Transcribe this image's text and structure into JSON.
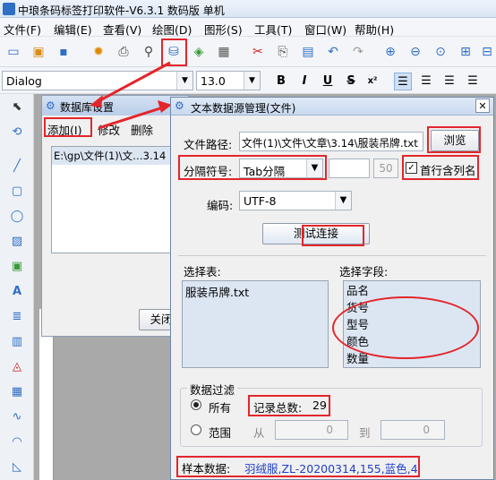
{
  "app": {
    "title": "中琅条码标签打印软件-V6.3.1 数码版 单机"
  },
  "menu": [
    "文件(F)",
    "编辑(E)",
    "查看(V)",
    "绘图(D)",
    "图形(S)",
    "工具(T)",
    "窗口(W)",
    "帮助(H)"
  ],
  "toolbar": {
    "font_name": "Dialog",
    "font_size": "13.0",
    "bold": "B",
    "italic": "I",
    "underline": "U",
    "strike": "S"
  },
  "db_window": {
    "title": "数据库设置",
    "add": "添加(I)",
    "edit": "修改",
    "delete": "删除",
    "item": "E:\\gp\\文件(1)\\文…3.14",
    "close": "关闭"
  },
  "dialog": {
    "title": "文本数据源管理(文件)",
    "close_glyph": "✕",
    "path_label": "文件路径:",
    "path_value": "文件(1)\\文件\\文章\\3.14\\服装吊牌.txt",
    "browse": "浏览",
    "separator_label": "分隔符号:",
    "separator_value": "Tab分隔",
    "sep_num": "50",
    "first_row_label": "首行含列名",
    "encoding_label": "编码:",
    "encoding_value": "UTF-8",
    "test_button": "测试连接",
    "select_table_label": "选择表:",
    "tables": [
      "服装吊牌.txt"
    ],
    "select_field_label": "选择字段:",
    "fields": [
      "品名",
      "货号",
      "型号",
      "颜色",
      "数量"
    ],
    "filter_label": "数据过滤",
    "all_label": "所有",
    "record_label": "记录总数:",
    "record_count": "29",
    "range_label": "范围",
    "from_label": "从",
    "to_label": "到",
    "from_value": "0",
    "to_value": "0",
    "sample_label": "样本数据:",
    "sample_value": "羽绒服,ZL-20200314,155,蓝色,4"
  },
  "colors": {
    "highlight": "#e3262b",
    "accent": "#2f6fc6"
  }
}
